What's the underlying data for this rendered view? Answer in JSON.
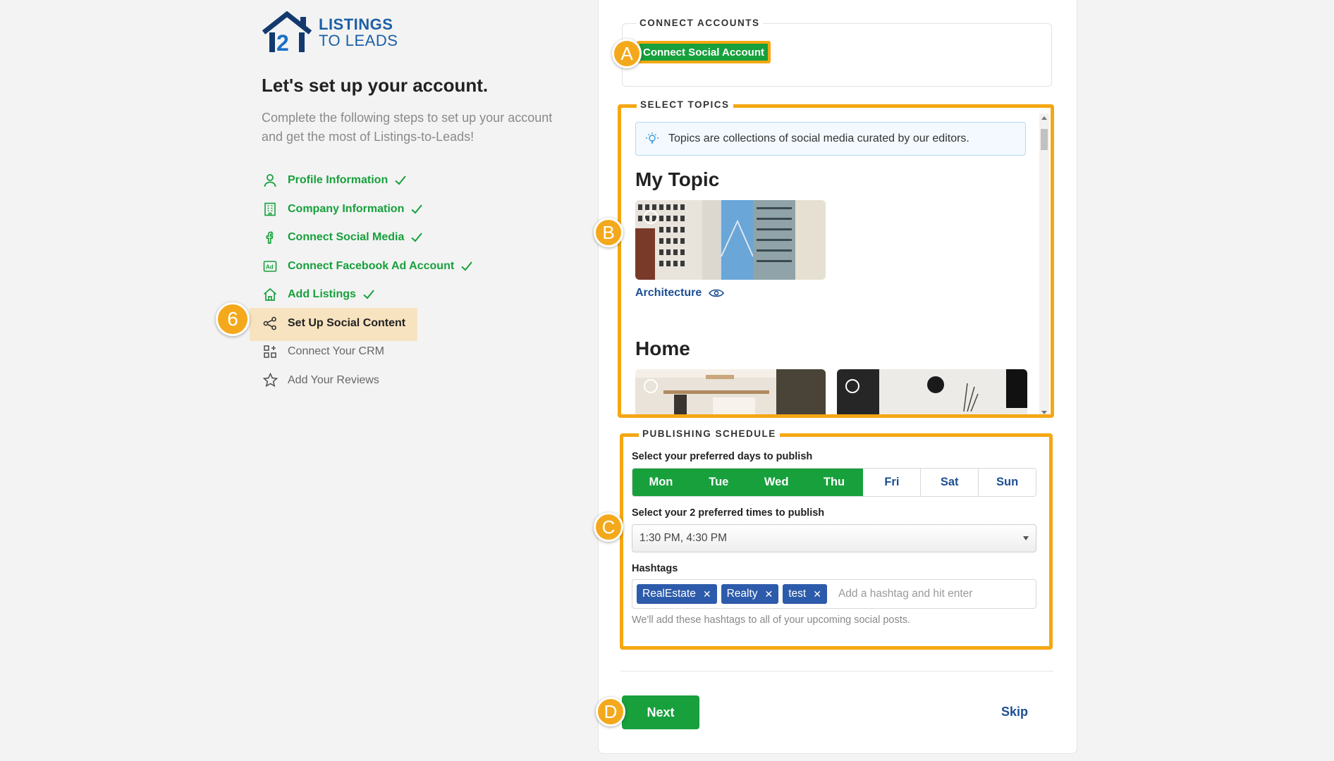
{
  "brand": {
    "line1": "LISTINGS",
    "line2": "TO LEADS"
  },
  "setup": {
    "title": "Let's set up your account.",
    "description": "Complete the following steps to set up your account and get the most of Listings-to-Leads!"
  },
  "steps": [
    {
      "label": "Profile Information",
      "state": "done",
      "icon": "user-icon"
    },
    {
      "label": "Company Information",
      "state": "done",
      "icon": "building-icon"
    },
    {
      "label": "Connect Social Media",
      "state": "done",
      "icon": "facebook-icon"
    },
    {
      "label": "Connect Facebook Ad Account",
      "state": "done",
      "icon": "ad-icon"
    },
    {
      "label": "Add Listings",
      "state": "done",
      "icon": "home-icon"
    },
    {
      "label": "Set Up Social Content",
      "state": "active",
      "icon": "share-icon"
    },
    {
      "label": "Connect Your CRM",
      "state": "pending",
      "icon": "apps-icon"
    },
    {
      "label": "Add Your Reviews",
      "state": "pending",
      "icon": "star-icon"
    }
  ],
  "annotations": {
    "step": "6",
    "a": "A",
    "b": "B",
    "c": "C",
    "d": "D"
  },
  "connect": {
    "legend": "CONNECT ACCOUNTS",
    "button": "Connect Social Account"
  },
  "topics": {
    "legend": "SELECT TOPICS",
    "info": "Topics are collections of social media curated by our editors.",
    "groups": [
      {
        "heading": "My Topic",
        "items": [
          {
            "label": "Architecture"
          }
        ]
      },
      {
        "heading": "Home"
      }
    ]
  },
  "schedule": {
    "legend": "PUBLISHING SCHEDULE",
    "days_label": "Select your preferred days to publish",
    "days": [
      {
        "label": "Mon",
        "selected": true
      },
      {
        "label": "Tue",
        "selected": true
      },
      {
        "label": "Wed",
        "selected": true
      },
      {
        "label": "Thu",
        "selected": true
      },
      {
        "label": "Fri",
        "selected": false
      },
      {
        "label": "Sat",
        "selected": false
      },
      {
        "label": "Sun",
        "selected": false
      }
    ],
    "times_label": "Select your 2 preferred times to publish",
    "times_value": "1:30 PM, 4:30 PM",
    "hashtags_label": "Hashtags",
    "hashtags": [
      "RealEstate",
      "Realty",
      "test"
    ],
    "hashtag_placeholder": "Add a hashtag and hit enter",
    "hashtag_help": "We'll add these hashtags to all of your upcoming social posts."
  },
  "actions": {
    "next": "Next",
    "skip": "Skip"
  },
  "colors": {
    "green": "#17a03c",
    "blue": "#1c4e94",
    "highlight": "#f5a712",
    "active_bg": "#f8e3c0"
  }
}
